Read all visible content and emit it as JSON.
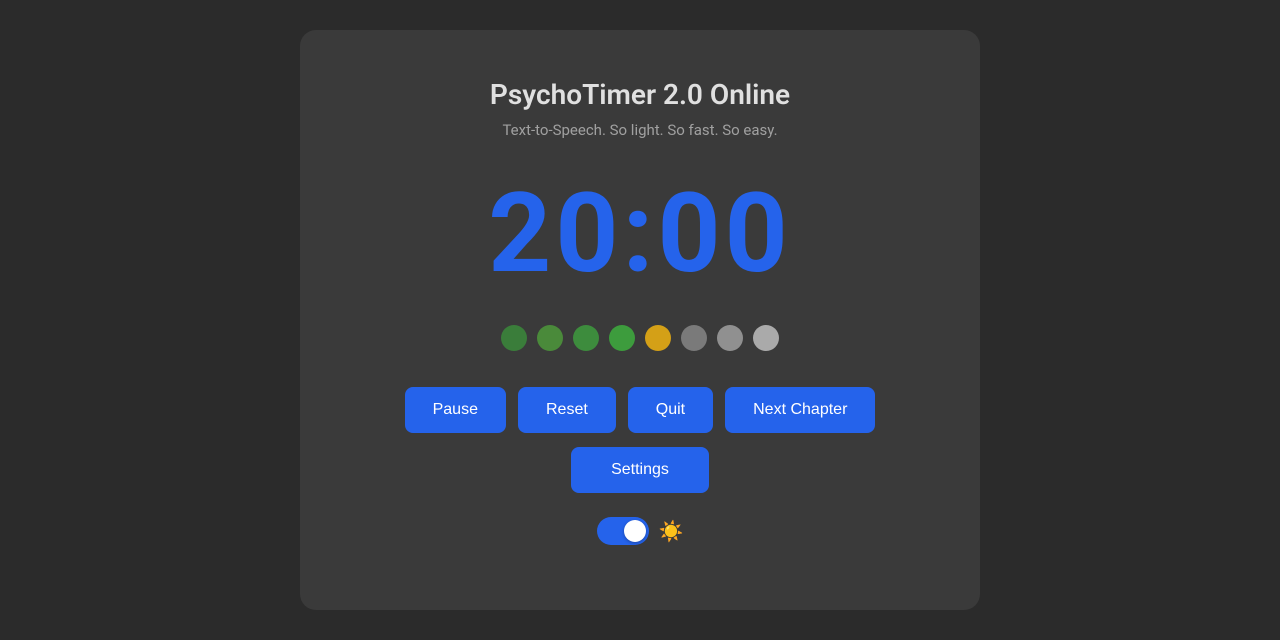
{
  "app": {
    "title": "PsychoTimer 2.0 Online",
    "subtitle": "Text-to-Speech. So light. So fast. So easy."
  },
  "timer": {
    "display": "20:00"
  },
  "dots": [
    {
      "color": "green-dark",
      "filled": true
    },
    {
      "color": "green-mid",
      "filled": true
    },
    {
      "color": "green",
      "filled": true
    },
    {
      "color": "green-bright",
      "filled": true
    },
    {
      "color": "yellow",
      "filled": true
    },
    {
      "color": "gray1",
      "filled": false
    },
    {
      "color": "gray2",
      "filled": false
    },
    {
      "color": "gray3",
      "filled": false
    }
  ],
  "buttons": {
    "pause": "Pause",
    "reset": "Reset",
    "quit": "Quit",
    "next_chapter": "Next Chapter",
    "settings": "Settings"
  },
  "toggle": {
    "checked": true
  },
  "icons": {
    "sun": "☀️"
  }
}
